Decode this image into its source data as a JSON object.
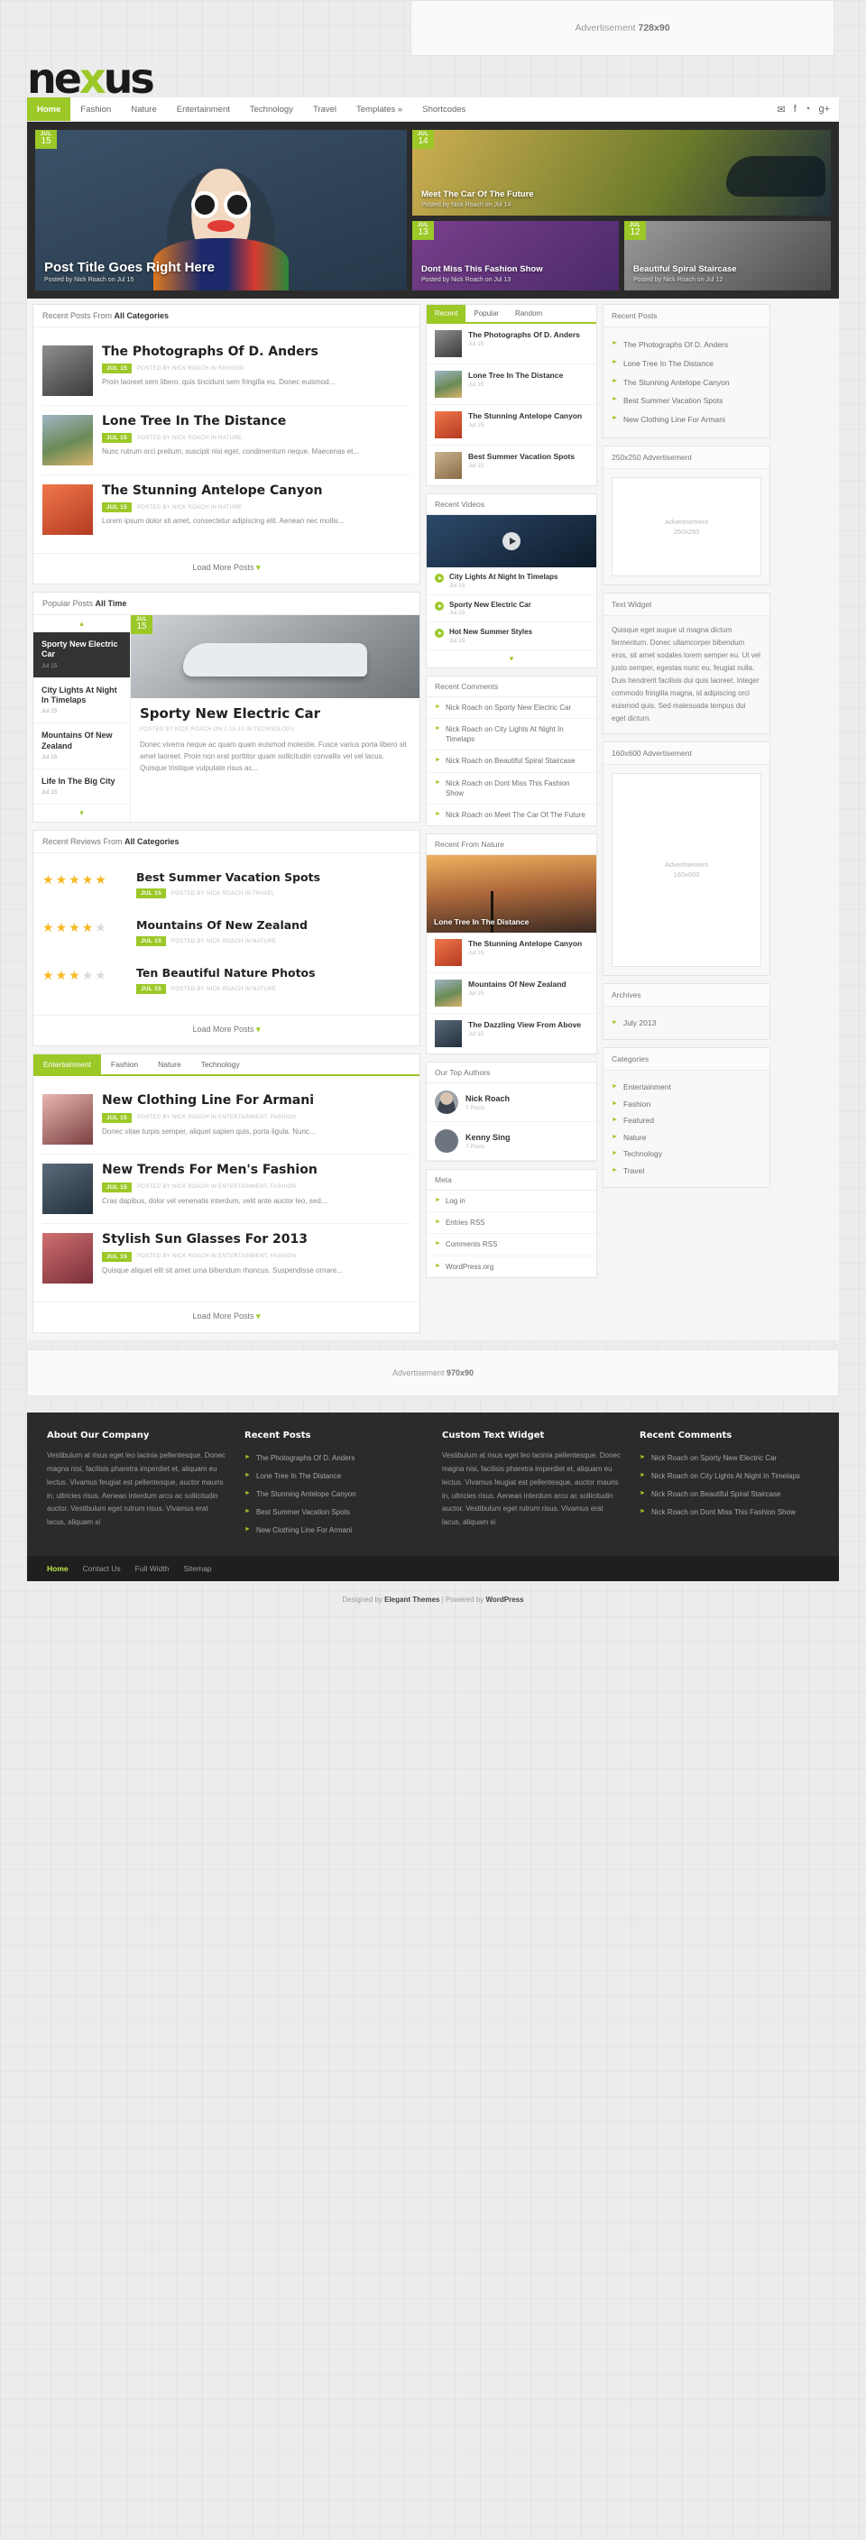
{
  "brand": {
    "name_part1": "ne",
    "name_x": "x",
    "name_part2": "us",
    "accent": "#9cc828"
  },
  "ads": {
    "top": {
      "label": "Advertisement",
      "size": "728x90"
    },
    "square": {
      "label": "Advertisement",
      "size": "250x250",
      "heading": "250x250 Advertisement"
    },
    "tall": {
      "label": "Advertisement",
      "size": "160x600",
      "heading": "160x600 Advertisement"
    },
    "bottom": {
      "label": "Advertisement",
      "size": "970x90"
    }
  },
  "nav": {
    "items": [
      {
        "label": "Home",
        "active": true
      },
      {
        "label": "Fashion",
        "active": false
      },
      {
        "label": "Nature",
        "active": false
      },
      {
        "label": "Entertainment",
        "active": false
      },
      {
        "label": "Technology",
        "active": false
      },
      {
        "label": "Travel",
        "active": false
      },
      {
        "label": "Templates »",
        "active": false
      },
      {
        "label": "Shortcodes",
        "active": false
      }
    ],
    "social": [
      {
        "name": "twitter-icon",
        "glyph": "✉"
      },
      {
        "name": "facebook-icon",
        "glyph": "f"
      },
      {
        "name": "rss-icon",
        "glyph": "◔"
      },
      {
        "name": "google-plus-icon",
        "glyph": "g+"
      }
    ]
  },
  "slider": {
    "main": {
      "month": "JUL",
      "day": "15",
      "title": "Post Title Goes Right Here",
      "byline": "Posted by Nick Roach on Jul 15"
    },
    "top": {
      "month": "JUL",
      "day": "14",
      "title": "Meet The Car Of The Future",
      "byline": "Posted by Nick Roach on Jul 14"
    },
    "left": {
      "month": "JUL",
      "day": "13",
      "title": "Dont Miss This Fashion Show",
      "byline": "Posted by Nick Roach on Jul 13"
    },
    "right": {
      "month": "JUL",
      "day": "12",
      "title": "Beautiful Spiral Staircase",
      "byline": "Posted by Nick Roach on Jul 12"
    }
  },
  "recent_posts_module": {
    "head_prefix": "Recent Posts From ",
    "head_bold": "All Categories",
    "posts": [
      {
        "title": "The Photographs Of D. Anders",
        "date": "JUL 15",
        "meta": "POSTED BY NICK ROACH IN FASHION",
        "excerpt": "Proin laoreet sem libero. quis tincidunt sem fringilla eu. Donec euismod...",
        "thumb": "t1"
      },
      {
        "title": "Lone Tree In The Distance",
        "date": "JUL 15",
        "meta": "POSTED BY NICK ROACH IN NATURE",
        "excerpt": "Nunc rutrum orci pretium, suscipit nisi eget, condimentum neque. Maecenas et...",
        "thumb": "t2"
      },
      {
        "title": "The Stunning Antelope Canyon",
        "date": "JUL 15",
        "meta": "POSTED BY NICK ROACH IN NATURE",
        "excerpt": "Lorem ipsum dolor sit amet, consectetur adipiscing elit. Aenean nec mollis...",
        "thumb": "t3"
      }
    ],
    "load_more": "Load More Posts"
  },
  "popular_module": {
    "head_prefix": "Popular Posts ",
    "head_bold": "All Time",
    "items": [
      {
        "title": "Sporty New Electric Car",
        "date": "Jul 15",
        "active": true
      },
      {
        "title": "City Lights At Night In Timelaps",
        "date": "Jul 15",
        "active": false
      },
      {
        "title": "Mountains Of New Zealand",
        "date": "Jul 15",
        "active": false
      },
      {
        "title": "Life In The Big City",
        "date": "Jul 15",
        "active": false
      }
    ],
    "featured": {
      "month": "JUL",
      "day": "15",
      "title": "Sporty New Electric Car",
      "meta": "POSTED BY NICK ROACH ON 7-15-13 IN TECHNOLOGY",
      "excerpt": "Donec viverra neque ac quam quam euismod molestie. Fusce varius porta libero sit amet laoreet. Proin non erat porttitor quam sollicitudin convallis vel vel lacus. Quisque tristique vulputate risus ac..."
    }
  },
  "reviews_module": {
    "head_prefix": "Recent Reviews From ",
    "head_bold": "All Categories",
    "reviews": [
      {
        "title": "Best Summer Vacation Spots",
        "date": "JUL 15",
        "meta": "POSTED BY NICK ROACH IN TRAVEL",
        "rating": 5
      },
      {
        "title": "Mountains Of New Zealand",
        "date": "JUL 15",
        "meta": "POSTED BY NICK ROACH IN NATURE",
        "rating": 4
      },
      {
        "title": "Ten Beautiful Nature Photos",
        "date": "JUL 15",
        "meta": "POSTED BY NICK ROACH IN NATURE",
        "rating": 3
      }
    ],
    "load_more": "Load More Posts"
  },
  "category_module": {
    "tabs": [
      {
        "label": "Entertainment",
        "active": true
      },
      {
        "label": "Fashion",
        "active": false
      },
      {
        "label": "Nature",
        "active": false
      },
      {
        "label": "Technology",
        "active": false
      }
    ],
    "posts": [
      {
        "title": "New Clothing Line For Armani",
        "date": "JUL 15",
        "meta": "POSTED BY NICK ROACH IN ENTERTAINMENT, FASHION",
        "excerpt": "Donec vitae turpis semper, aliquet sapien quis, porta ligula. Nunc...",
        "thumb": "t5"
      },
      {
        "title": "New Trends For Men's Fashion",
        "date": "JUL 15",
        "meta": "POSTED BY NICK ROACH IN ENTERTAINMENT, FASHION",
        "excerpt": "Cras dapibus, dolor vel venenatis interdum, velit ante auctor leo, sed...",
        "thumb": "t6"
      },
      {
        "title": "Stylish Sun Glasses For 2013",
        "date": "JUL 15",
        "meta": "POSTED BY NICK ROACH IN ENTERTAINMENT, FASHION",
        "excerpt": "Quisque aliquet elit sit amet urna bibendum rhoncus. Suspendisse ornare...",
        "thumb": "t7"
      }
    ],
    "load_more": "Load More Posts"
  },
  "mid": {
    "tabs": [
      {
        "label": "Recent",
        "active": true
      },
      {
        "label": "Popular",
        "active": false
      },
      {
        "label": "Random",
        "active": false
      }
    ],
    "tab_items": [
      {
        "title": "The Photographs Of D. Anders",
        "date": "Jul 15",
        "thumb": "t1"
      },
      {
        "title": "Lone Tree In The Distance",
        "date": "Jul 15",
        "thumb": "t2"
      },
      {
        "title": "The Stunning Antelope Canyon",
        "date": "Jul 15",
        "thumb": "t3"
      },
      {
        "title": "Best Summer Vacation Spots",
        "date": "Jul 15",
        "thumb": "t4"
      }
    ],
    "videos": {
      "heading": "Recent Videos",
      "items": [
        {
          "title": "City Lights At Night In Timelaps",
          "date": "Jul 15"
        },
        {
          "title": "Sporty New Electric Car",
          "date": "Jul 15"
        },
        {
          "title": "Hot New Summer Styles",
          "date": "Jul 15"
        }
      ]
    },
    "comments": {
      "heading": "Recent Comments",
      "items": [
        "Nick Roach on Sporty New Electric Car",
        "Nick Roach on City Lights At Night In Timelaps",
        "Nick Roach on Beautiful Spiral Staircase",
        "Nick Roach on Dont Miss This Fashion Show",
        "Nick Roach on Meet The Car Of The Future"
      ]
    },
    "from_nature": {
      "heading": "Recent From Nature",
      "feature": {
        "title": "Lone Tree In The Distance"
      },
      "items": [
        {
          "title": "The Stunning Antelope Canyon",
          "date": "Jul 15",
          "thumb": "t3"
        },
        {
          "title": "Mountains Of New Zealand",
          "date": "Jul 15",
          "thumb": "t2"
        },
        {
          "title": "The Dazzling View From Above",
          "date": "Jul 15",
          "thumb": "t6"
        }
      ]
    },
    "authors": {
      "heading": "Our Top Authors",
      "items": [
        {
          "name": "Nick Roach",
          "posts": "7 Posts"
        },
        {
          "name": "Kenny Sing",
          "posts": "7 Posts"
        }
      ]
    },
    "meta": {
      "heading": "Meta",
      "items": [
        "Log in",
        "Entries RSS",
        "Comments RSS",
        "WordPress.org"
      ]
    }
  },
  "sidebar": {
    "recent_posts": {
      "heading": "Recent Posts",
      "items": [
        "The Photographs Of D. Anders",
        "Lone Tree In The Distance",
        "The Stunning Antelope Canyon",
        "Best Summer Vacation Spots",
        "New Clothing Line For Armani"
      ]
    },
    "text_widget": {
      "heading": "Text Widget",
      "body": "Quisque eget augue ut magna dictum fermentum. Donec ullamcorper bibendum eros, sit amet sodales lorem semper eu. Ut vel justo semper, egestas nunc eu, feugiat nulla. Duis hendrerit facilisis dui quis laoreet. Integer commodo fringilla magna, id adipiscing orci euismod quis. Sed malesuada tempus dui eget dictum."
    },
    "archives": {
      "heading": "Archives",
      "items": [
        "July 2013"
      ]
    },
    "categories": {
      "heading": "Categories",
      "items": [
        "Entertainment",
        "Fashion",
        "Featured",
        "Nature",
        "Technology",
        "Travel"
      ]
    }
  },
  "footer": {
    "about": {
      "heading": "About Our Company",
      "body": "Vestibulum at risus eget leo lacinia pellentesque. Donec magna nisi, facilisis pharetra imperdiet et, aliquam eu lectus. Vivamus feugiat est pellentesque, auctor mauris in, ultricies risus. Aenean interdum arcu ac sollicitudin auctor. Vestibulum eget rutrum risus. Vivamus erat lacus, aliquam si"
    },
    "recent_posts": {
      "heading": "Recent Posts",
      "items": [
        "The Photographs Of D. Anders",
        "Lone Tree In The Distance",
        "The Stunning Antelope Canyon",
        "Best Summer Vacation Spots",
        "New Clothing Line For Armani"
      ]
    },
    "custom_text": {
      "heading": "Custom Text Widget",
      "body": "Vestibulum at risus eget leo lacinia pellentesque. Donec magna nisi, facilisis pharetra imperdiet et, aliquam eu lectus. Vivamus feugiat est pellentesque, auctor mauris in, ultricies risus. Aenean interdum arcu ac sollicitudin auctor. Vestibulum eget rutrum risus. Vivamus erat lacus, aliquam si"
    },
    "recent_comments": {
      "heading": "Recent Comments",
      "items": [
        "Nick Roach on Sporty New Electric Car",
        "Nick Roach on City Lights At Night In Timelaps",
        "Nick Roach on Beautiful Spiral Staircase",
        "Nick Roach on Dont Miss This Fashion Show"
      ]
    },
    "bottom_nav": [
      {
        "label": "Home",
        "active": true
      },
      {
        "label": "Contact Us",
        "active": false
      },
      {
        "label": "Full Width",
        "active": false
      },
      {
        "label": "Sitemap",
        "active": false
      }
    ],
    "credit_prefix": "Designed by ",
    "credit_brand": "Elegant Themes",
    "credit_mid": " | Powered by ",
    "credit_cms": "WordPress"
  }
}
